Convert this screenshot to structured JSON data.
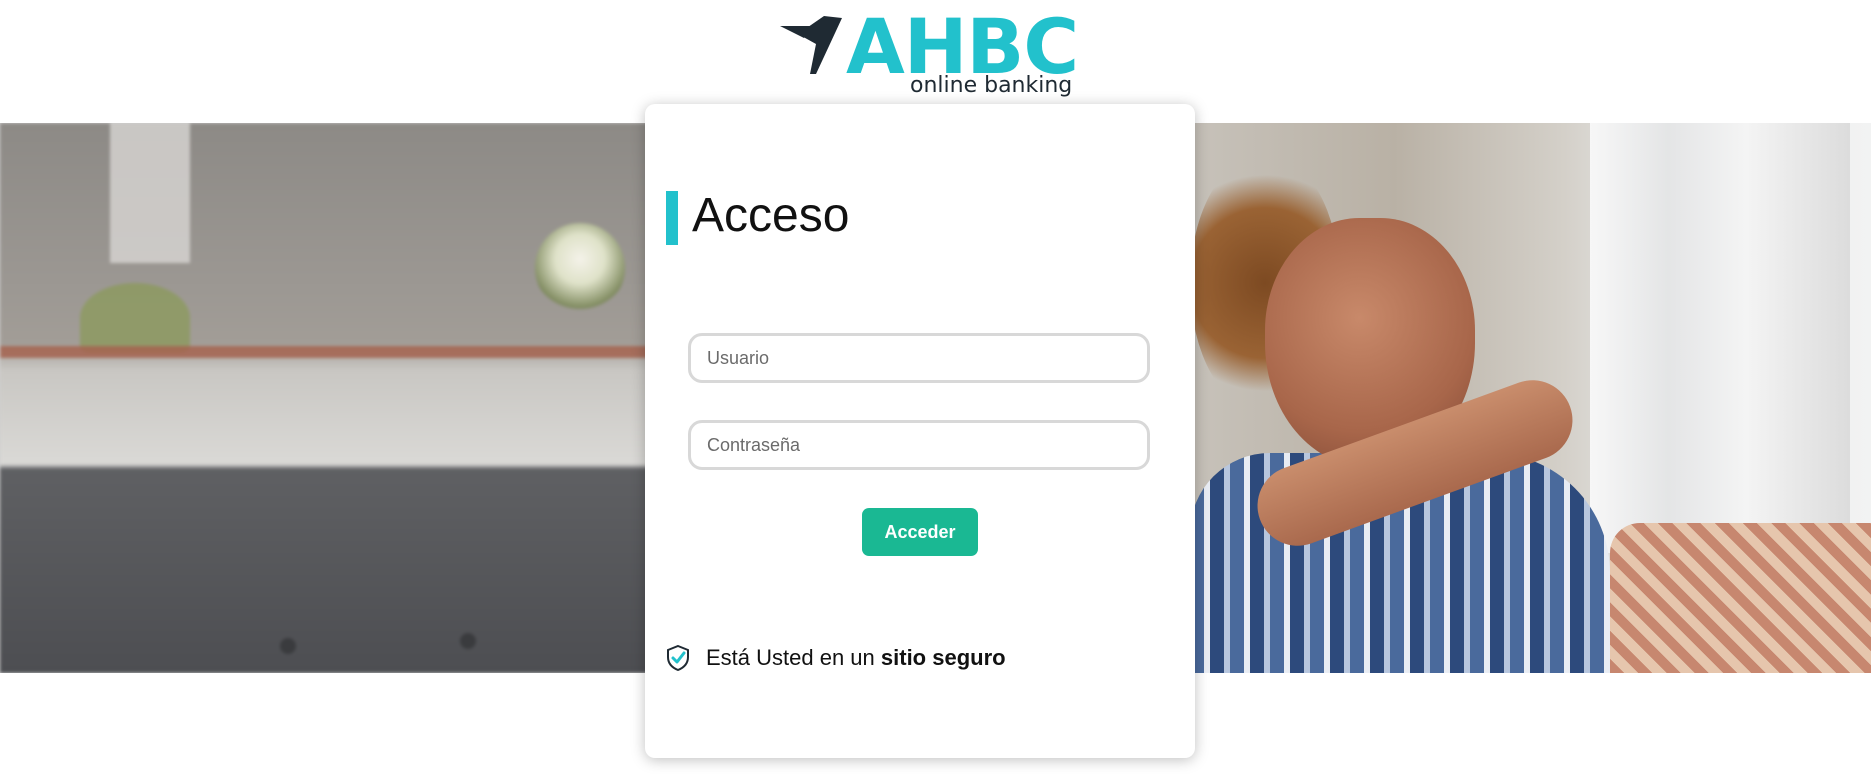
{
  "brand": {
    "name": "AHBC",
    "tagline": "online banking",
    "accent_color": "#22c1cc",
    "mark_icon": "bird-icon"
  },
  "login": {
    "title": "Acceso",
    "username_placeholder": "Usuario",
    "password_placeholder": "Contraseña",
    "submit_label": "Acceder",
    "submit_color": "#1ab893"
  },
  "security": {
    "icon": "shield-check-icon",
    "text_prefix": "Está Usted en un ",
    "text_bold": "sitio seguro"
  }
}
